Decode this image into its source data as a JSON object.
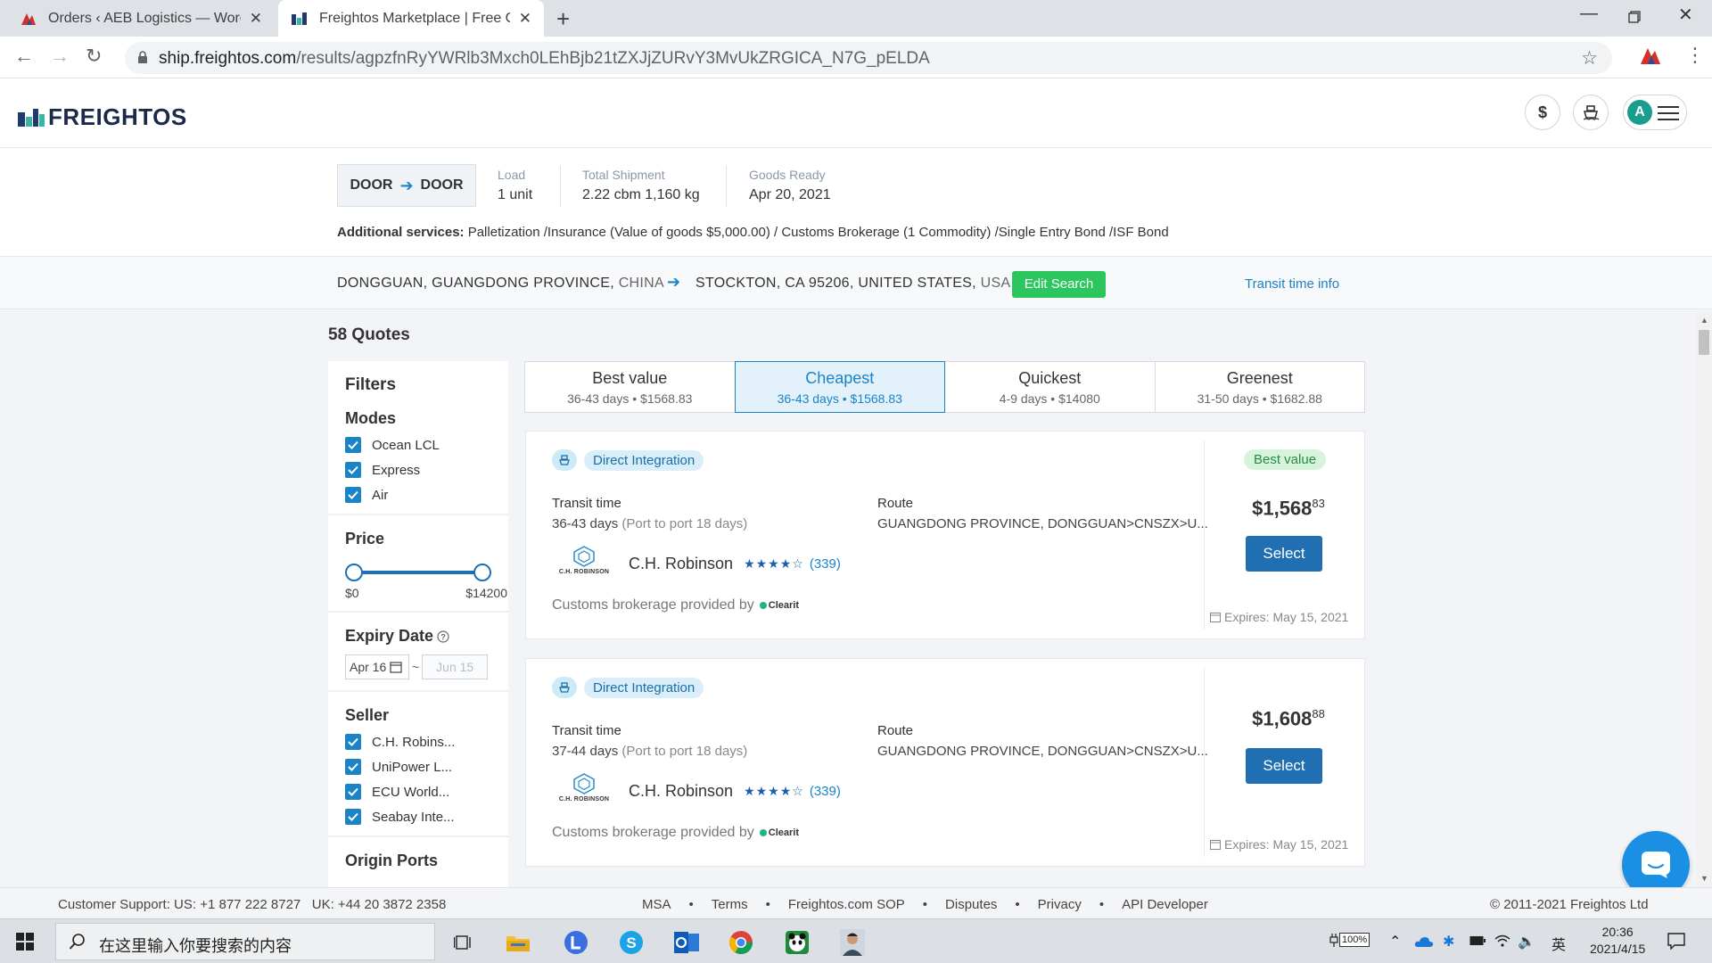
{
  "browser": {
    "tabs": [
      {
        "title": "Orders ‹ AEB Logistics — WordPress",
        "active": false
      },
      {
        "title": "Freightos Marketplace | Free Online Freight Quotes",
        "active": true
      }
    ],
    "url_host": "ship.freightos.com",
    "url_path": "/results/agpzfnRyYWRlb3Mxch0LEhBjb21tZXJjZURvY3MvUkZRGICA_N7G_pELDA"
  },
  "header": {
    "logo_text": "FREIGHTOS",
    "currency_label": "$",
    "avatar_initial": "A"
  },
  "summary": {
    "from_mode": "DOOR",
    "to_mode": "DOOR",
    "load_label": "Load",
    "load_value": "1 unit",
    "shipment_label": "Total Shipment",
    "shipment_value": "2.22 cbm 1,160 kg",
    "ready_label": "Goods Ready",
    "ready_value": "Apr 20, 2021",
    "services_label": "Additional services:",
    "services_value": " Palletization /Insurance (Value of goods $5,000.00) / Customs Brokerage (1 Commodity) /Single Entry Bond /ISF Bond"
  },
  "route": {
    "origin": "DONGGUAN, GUANGDONG PROVINCE, ",
    "origin_country": "CHINA",
    "destination": "STOCKTON, CA 95206, UNITED STATES, ",
    "destination_country": "USA",
    "edit_label": "Edit Search",
    "transit_info_label": "Transit time info"
  },
  "results": {
    "count_label": "58 Quotes"
  },
  "filters": {
    "title": "Filters",
    "modes_title": "Modes",
    "modes": [
      "Ocean LCL",
      "Express",
      "Air"
    ],
    "price_title": "Price",
    "price_min_label": "$0",
    "price_max_label": "$14200",
    "price_range": [
      0,
      1
    ],
    "expiry_title": "Expiry Date",
    "expiry_from": "Apr 16",
    "expiry_sep": "~",
    "expiry_to": "Jun 15",
    "seller_title": "Seller",
    "sellers": [
      "C.H. Robins...",
      "UniPower L...",
      "ECU World...",
      "Seabay Inte..."
    ],
    "origin_ports_title": "Origin Ports"
  },
  "sort_tabs": [
    {
      "label": "Best value",
      "sub": "36-43 days • $1568.83",
      "active": false
    },
    {
      "label": "Cheapest",
      "sub": "36-43 days • $1568.83",
      "active": true
    },
    {
      "label": "Quickest",
      "sub": "4-9 days • $14080",
      "active": false
    },
    {
      "label": "Greenest",
      "sub": "31-50 days • $1682.88",
      "active": false
    }
  ],
  "quotes": [
    {
      "badge": "Direct Integration",
      "best_value_badge": "Best value",
      "transit_label": "Transit time",
      "transit_value": "36-43 days",
      "transit_note": " (Port to port 18 days)",
      "route_label": "Route",
      "route_value": "GUANGDONG PROVINCE, DONGGUAN>CNSZX>U...",
      "carrier_logo_text": "C.H. ROBINSON",
      "carrier": "C.H. Robinson",
      "rating": 4.5,
      "rating_stars": "★★★★☆",
      "reviews": "(339)",
      "customs_text": "Customs brokerage provided by",
      "customs_partner": "Clearit",
      "price_main": "$1,568",
      "price_cents": "83",
      "select_label": "Select",
      "expires": "Expires: May 15, 2021"
    },
    {
      "badge": "Direct Integration",
      "best_value_badge": "",
      "transit_label": "Transit time",
      "transit_value": "37-44 days",
      "transit_note": " (Port to port 18 days)",
      "route_label": "Route",
      "route_value": "GUANGDONG PROVINCE, DONGGUAN>CNSZX>U...",
      "carrier_logo_text": "C.H. ROBINSON",
      "carrier": "C.H. Robinson",
      "rating": 4.5,
      "rating_stars": "★★★★☆",
      "reviews": "(339)",
      "customs_text": "Customs brokerage provided by",
      "customs_partner": "Clearit",
      "price_main": "$1,608",
      "price_cents": "88",
      "select_label": "Select",
      "expires": "Expires: May 15, 2021"
    }
  ],
  "footer": {
    "support": "Customer Support: US: +1 877 222 8727   UK: +44 20 3872 2358",
    "links": [
      "MSA",
      "Terms",
      "Freightos.com SOP",
      "Disputes",
      "Privacy",
      "API Developer"
    ],
    "separator": "•",
    "copyright": "© 2011-2021 Freightos Ltd"
  },
  "taskbar": {
    "search_placeholder": "在这里输入你要搜索的内容",
    "battery": "100%",
    "ime": "英",
    "time": "20:36",
    "date": "2021/4/15"
  },
  "colors": {
    "accent_blue": "#1a84c7",
    "button_blue": "#1f6fb2",
    "edit_green": "#2cc65e",
    "best_value_green": "#2a8a45"
  }
}
